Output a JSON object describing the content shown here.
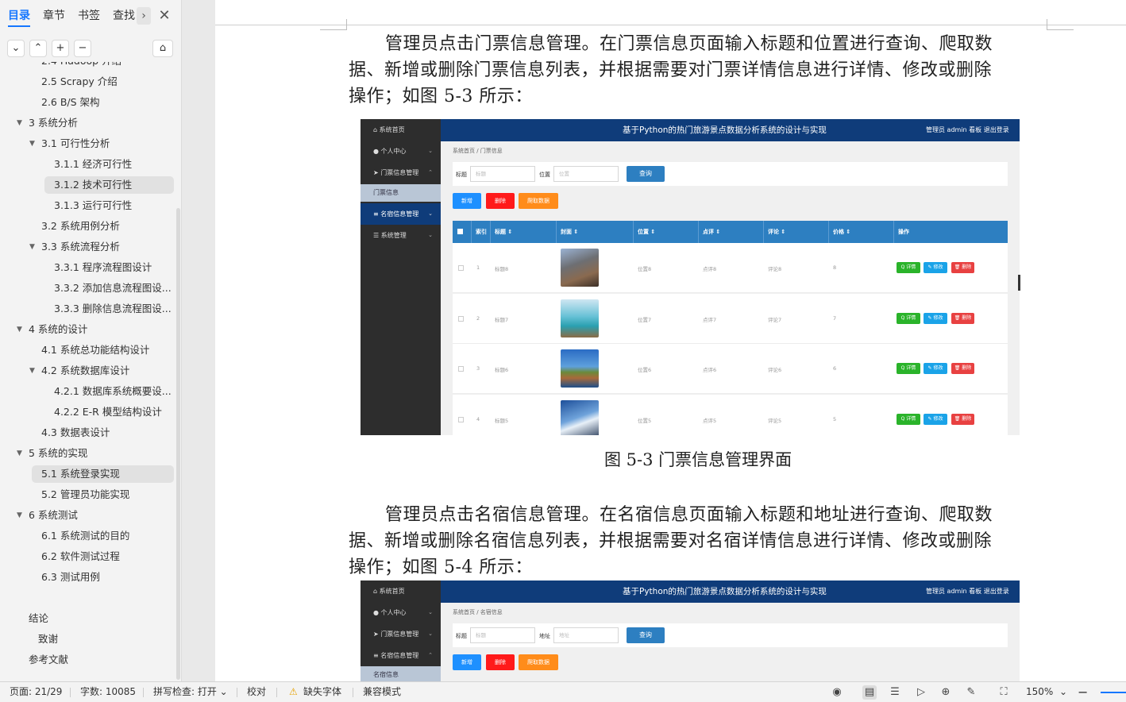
{
  "sidebar": {
    "tabs": [
      "目录",
      "章节",
      "书签",
      "查找"
    ],
    "active_tab": "目录",
    "next_glyph": "›",
    "close_glyph": "✕",
    "toolbar": {
      "collapse": "⌄",
      "expand": "⌃",
      "add": "+",
      "remove": "−",
      "clean": "⌂"
    },
    "toc": [
      {
        "label": "2.4 Hadoop 介绍",
        "level": 2
      },
      {
        "label": "2.5 Scrapy 介绍",
        "level": 2
      },
      {
        "label": "2.6 B/S 架构",
        "level": 2
      },
      {
        "label": "3    系统分析",
        "level": 1,
        "arrow": "▼"
      },
      {
        "label": "3.1    可行性分析",
        "level": 2,
        "arrow": "▼"
      },
      {
        "label": "3.1.1 经济可行性",
        "level": 3
      },
      {
        "label": "3.1.2 技术可行性",
        "level": 3,
        "selected": true
      },
      {
        "label": "3.1.3 运行可行性",
        "level": 3
      },
      {
        "label": "3.2 系统用例分析",
        "level": 2
      },
      {
        "label": "3.3 系统流程分析",
        "level": 2,
        "arrow": "▼"
      },
      {
        "label": "3.3.1 程序流程图设计",
        "level": 3
      },
      {
        "label": "3.3.2 添加信息流程图设...",
        "level": 3
      },
      {
        "label": "3.3.3 删除信息流程图设...",
        "level": 3
      },
      {
        "label": "4    系统的设计",
        "level": 1,
        "arrow": "▼"
      },
      {
        "label": "4.1  系统总功能结构设计",
        "level": 2
      },
      {
        "label": "4.2  系统数据库设计",
        "level": 2,
        "arrow": "▼"
      },
      {
        "label": "4.2.1  数据库系统概要设...",
        "level": 3
      },
      {
        "label": "4.2.2 E-R 模型结构设计",
        "level": 3
      },
      {
        "label": "4.3 数据表设计",
        "level": 2
      },
      {
        "label": "5    系统的实现",
        "level": 1,
        "arrow": "▼"
      },
      {
        "label": "5.1 系统登录实现",
        "level": 2,
        "selected": true
      },
      {
        "label": "5.2 管理员功能实现",
        "level": 2
      },
      {
        "label": "6 系统测试",
        "level": 1,
        "arrow": "▼"
      },
      {
        "label": "6.1 系统测试的目的",
        "level": 2
      },
      {
        "label": "6.2 软件测试过程",
        "level": 2
      },
      {
        "label": "6.3 测试用例",
        "level": 2
      },
      {
        "label": "结论",
        "level": 0
      },
      {
        "label": "致谢",
        "level": 0,
        "indent": true
      },
      {
        "label": "参考文献",
        "level": 0
      }
    ]
  },
  "document": {
    "para1": [
      "管理员点击门票信息管理。在门票信息页面输入标题和位置进行查询、爬取数",
      "据、新增或删除门票信息列表，并根据需要对门票详情信息进行详情、修改或删除",
      "操作；如图 5-3 所示："
    ],
    "caption1": "图 5-3 门票信息管理界面",
    "para2": [
      "管理员点击名宿信息管理。在名宿信息页面输入标题和地址进行查询、爬取数",
      "据、新增或删除名宿信息列表，并根据需要对名宿详情信息进行详情、修改或删除",
      "操作；如图 5-4 所示："
    ]
  },
  "shot1": {
    "title": "基于Python的热门旅游景点数据分析系统的设计与实现",
    "userinfo": "管理员 admin  看板  退出登录",
    "sidebar": [
      "系统首页",
      "个人中心",
      "门票信息管理",
      "门票信息",
      "名宿信息管理",
      "系统管理"
    ],
    "breadcrumb": "系统首页  /  门票信息",
    "filter": {
      "label1": "标题",
      "ph1": "标题",
      "label2": "位置",
      "ph2": "位置",
      "query": "查询"
    },
    "actions": {
      "add": "新增",
      "delete": "删除",
      "crawl": "爬取数据"
    },
    "columns": [
      "索引",
      "标题 ⇕",
      "封面 ⇕",
      "位置 ⇕",
      "点评 ⇕",
      "评论 ⇕",
      "价格 ⇕",
      "操作"
    ],
    "rows": [
      {
        "idx": "1",
        "title": "标题8",
        "loc": "位置8",
        "review": "点评8",
        "comment": "评论8",
        "price": "8"
      },
      {
        "idx": "2",
        "title": "标题7",
        "loc": "位置7",
        "review": "点评7",
        "comment": "评论7",
        "price": "7"
      },
      {
        "idx": "3",
        "title": "标题6",
        "loc": "位置6",
        "review": "点评6",
        "comment": "评论6",
        "price": "6"
      },
      {
        "idx": "4",
        "title": "标题5",
        "loc": "位置5",
        "review": "点评5",
        "comment": "评论5",
        "price": "5"
      }
    ],
    "ops": {
      "detail": "Q 详情",
      "edit": "✎ 修改",
      "del": "🗑 删除"
    }
  },
  "shot2": {
    "title": "基于Python的热门旅游景点数据分析系统的设计与实现",
    "userinfo": "管理员 admin  看板  退出登录",
    "sidebar": [
      "系统首页",
      "个人中心",
      "门票信息管理",
      "名宿信息管理",
      "名宿信息"
    ],
    "breadcrumb": "系统首页  /  名宿信息",
    "filter": {
      "label1": "标题",
      "ph1": "标题",
      "label2": "地址",
      "ph2": "地址",
      "query": "查询"
    },
    "actions": {
      "add": "新增",
      "delete": "删除",
      "crawl": "爬取数据"
    }
  },
  "status": {
    "page": "页面: 21/29",
    "words": "字数: 10085",
    "spell": "拼写检查: 打开 ⌄",
    "proof": "校对",
    "missing_font": "缺失字体",
    "compat": "兼容模式",
    "zoom": "150%",
    "zoom_caret": "⌄"
  },
  "colors": {
    "accent": "#1677ff",
    "shot_header": "#0f3c7a",
    "shot_table_header": "#2d7fc1",
    "btn_add": "#1e90ff",
    "btn_delete": "#ff1a1a",
    "btn_crawl": "#ff8c1a",
    "op_detail": "#2ab32a",
    "op_edit": "#1aa3e8",
    "op_delete": "#e84141"
  }
}
